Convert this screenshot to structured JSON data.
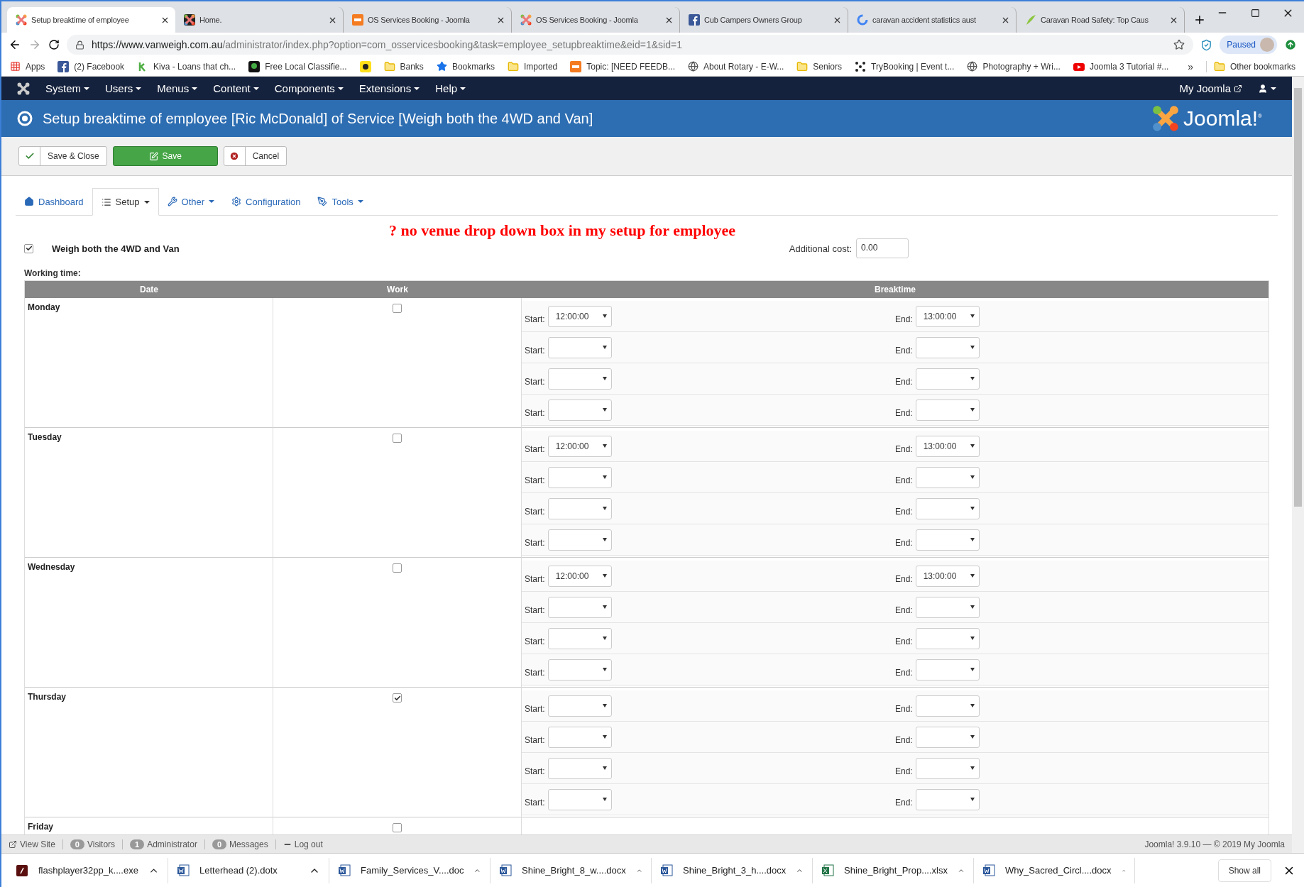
{
  "browser": {
    "tabs": [
      {
        "title": "Setup breaktime of employee",
        "kind": "joomla",
        "selected": true
      },
      {
        "title": "Home.",
        "kind": "joomla-dark",
        "selected": false
      },
      {
        "title": "OS Services Booking - Joomla",
        "kind": "os",
        "selected": false
      },
      {
        "title": "OS Services Booking - Joomla",
        "kind": "joomla",
        "selected": false
      },
      {
        "title": "Cub Campers Owners Group",
        "kind": "facebook",
        "selected": false
      },
      {
        "title": "caravan accident statistics aust",
        "kind": "google",
        "selected": false
      },
      {
        "title": "Caravan Road Safety: Top Caus",
        "kind": "leaf",
        "selected": false
      }
    ],
    "url": {
      "host": "https://www.vanweigh.com.au",
      "path": "/administrator/index.php?option=com_osservicesbooking&task=employee_setupbreaktime&eid=1&sid=1"
    },
    "profile": "Paused",
    "bookmarks": [
      {
        "label": "Apps",
        "kind": "apps"
      },
      {
        "label": "(2) Facebook",
        "kind": "facebook"
      },
      {
        "label": "Kiva - Loans that ch...",
        "kind": "kiva"
      },
      {
        "label": "Free Local Classifie...",
        "kind": "tree"
      },
      {
        "kind": "mail"
      },
      {
        "label": "Banks",
        "kind": "folder"
      },
      {
        "label": "Bookmarks",
        "kind": "star"
      },
      {
        "label": "Imported",
        "kind": "folder"
      },
      {
        "label": "Topic: [NEED FEEDB...",
        "kind": "os"
      },
      {
        "label": "About Rotary - E-W...",
        "kind": "globe"
      },
      {
        "label": "Seniors",
        "kind": "folder"
      },
      {
        "label": "TryBooking | Event t...",
        "kind": "dots"
      },
      {
        "label": "Photography + Wri...",
        "kind": "globe"
      },
      {
        "label": "Joomla 3 Tutorial #...",
        "kind": "youtube"
      }
    ],
    "bookmarks_more": "»",
    "other_bookmarks": "Other bookmarks"
  },
  "admin_menu": {
    "items": [
      "System",
      "Users",
      "Menus",
      "Content",
      "Components",
      "Extensions",
      "Help"
    ],
    "my_joomla": "My Joomla"
  },
  "header": {
    "title": "Setup breaktime of employee [Ric McDonald] of Service [Weigh both the 4WD and Van]",
    "logo": "Joomla!$^{®}$"
  },
  "toolbar": [
    {
      "label": "Save & Close",
      "kind": "check"
    },
    {
      "label": "Save",
      "kind": "primary"
    },
    {
      "label": "Cancel",
      "kind": "cancel"
    }
  ],
  "subnav": [
    {
      "label": "Dashboard",
      "kind": "home",
      "dropdown": false,
      "selected": false
    },
    {
      "label": "Setup",
      "kind": "list",
      "dropdown": true,
      "selected": true
    },
    {
      "label": "Other",
      "kind": "wrench",
      "dropdown": true,
      "selected": false
    },
    {
      "label": "Configuration",
      "kind": "gear",
      "dropdown": false,
      "selected": false
    },
    {
      "label": "Tools",
      "kind": "screwdriver",
      "dropdown": true,
      "selected": false
    }
  ],
  "note": "? no venue drop down box in my setup for employee",
  "service": {
    "name": "Weigh both the 4WD and Van",
    "checked": true,
    "cost_label": "Additional cost:",
    "cost": "0.00"
  },
  "working_time_label": "Working time:",
  "table": {
    "columns": [
      "Date",
      "Work",
      "Breaktime"
    ],
    "rows": [
      {
        "day": "Monday",
        "work": false,
        "slots": [
          {
            "start_label": "Start:",
            "start": "12:00:00",
            "end_label": "End:",
            "end": "13:00:00"
          },
          {
            "start_label": "Start:",
            "end_label": "End:"
          },
          {
            "start_label": "Start:",
            "end_label": "End:"
          },
          {
            "start_label": "Start:",
            "end_label": "End:"
          }
        ]
      },
      {
        "day": "Tuesday",
        "work": false,
        "slots": [
          {
            "start_label": "Start:",
            "start": "12:00:00",
            "end_label": "End:",
            "end": "13:00:00"
          },
          {
            "start_label": "Start:",
            "end_label": "End:"
          },
          {
            "start_label": "Start:",
            "end_label": "End:"
          },
          {
            "start_label": "Start:",
            "end_label": "End:"
          }
        ]
      },
      {
        "day": "Wednesday",
        "work": false,
        "slots": [
          {
            "start_label": "Start:",
            "start": "12:00:00",
            "end_label": "End:",
            "end": "13:00:00"
          },
          {
            "start_label": "Start:",
            "end_label": "End:"
          },
          {
            "start_label": "Start:",
            "end_label": "End:"
          },
          {
            "start_label": "Start:",
            "end_label": "End:"
          }
        ]
      },
      {
        "day": "Thursday",
        "work": true,
        "slots": [
          {
            "start_label": "Start:",
            "end_label": "End:"
          },
          {
            "start_label": "Start:",
            "end_label": "End:"
          },
          {
            "start_label": "Start:",
            "end_label": "End:"
          },
          {
            "start_label": "Start:",
            "end_label": "End:"
          }
        ]
      },
      {
        "day": "Friday",
        "work": false
      }
    ]
  },
  "status_bar": {
    "items": [
      {
        "label": "View Site",
        "kind": "link"
      },
      {
        "count": "0",
        "label": "Visitors",
        "kind": "badge"
      },
      {
        "count": "1",
        "label": "Administrator",
        "kind": "badge"
      },
      {
        "count": "0",
        "label": "Messages",
        "kind": "badge"
      },
      {
        "label": "Log out",
        "kind": "logout"
      }
    ],
    "version": "Joomla! 3.9.10",
    "copyright": "© 2019 My Joomla",
    "separator": "—"
  },
  "downloads": {
    "items": [
      {
        "name": "flashplayer32pp_k....exe",
        "kind": "exe"
      },
      {
        "name": "Letterhead (2).dotx",
        "kind": "word"
      },
      {
        "name": "Family_Services_V....doc",
        "kind": "word"
      },
      {
        "name": "Shine_Bright_8_w....docx",
        "kind": "word"
      },
      {
        "name": "Shine_Bright_3_h....docx",
        "kind": "word"
      },
      {
        "name": "Shine_Bright_Prop....xlsx",
        "kind": "excel"
      },
      {
        "name": "Why_Sacred_Circl....docx",
        "kind": "word"
      }
    ],
    "show_all": "Show all"
  }
}
